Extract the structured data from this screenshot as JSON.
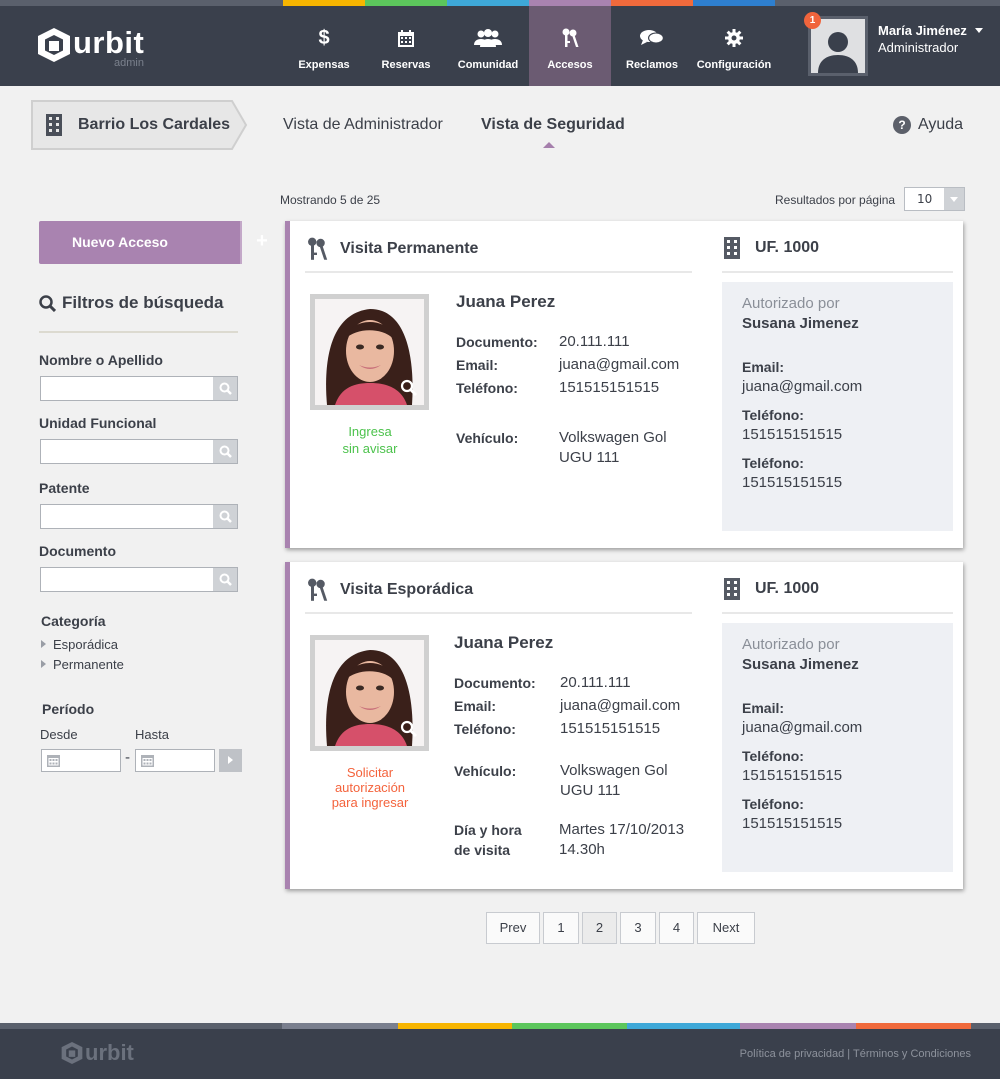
{
  "brand": {
    "name": "urbit",
    "sub": "admin"
  },
  "colors": {
    "stripe": [
      "#5a606c",
      "#f7b500",
      "#5cc65c",
      "#3ea8d8",
      "#a983b0",
      "#f06a3c",
      "#2e7fcf",
      "#5a606c"
    ],
    "accent": "#a983b0",
    "status_ok": "#4cc24c",
    "status_warn": "#f4633c"
  },
  "nav": [
    {
      "label": "Expensas",
      "icon": "dollar-icon",
      "active": false
    },
    {
      "label": "Reservas",
      "icon": "calendar-icon",
      "active": false
    },
    {
      "label": "Comunidad",
      "icon": "people-icon",
      "active": false
    },
    {
      "label": "Accesos",
      "icon": "keys-icon",
      "active": true
    },
    {
      "label": "Reclamos",
      "icon": "chat-icon",
      "active": false
    },
    {
      "label": "Configuración",
      "icon": "gear-icon",
      "active": false
    }
  ],
  "user": {
    "name": "María Jiménez",
    "role": "Administrador",
    "notifications": "1"
  },
  "subheader": {
    "barrio": "Barrio Los Cardales",
    "tab_admin": "Vista de Administrador",
    "tab_security": "Vista de Seguridad",
    "help": "Ayuda"
  },
  "sidebar": {
    "new_button": "Nuevo Acceso",
    "new_plus": "+",
    "filters_title": "Filtros de búsqueda",
    "fields": [
      {
        "label": "Nombre o Apellido",
        "value": ""
      },
      {
        "label": "Unidad Funcional",
        "value": ""
      },
      {
        "label": "Patente",
        "value": ""
      },
      {
        "label": "Documento",
        "value": ""
      }
    ],
    "category_title": "Categoría",
    "categories": [
      "Esporádica",
      "Permanente"
    ],
    "period_title": "Período",
    "from_label": "Desde",
    "to_label": "Hasta",
    "dash": "-"
  },
  "results": {
    "showing": "Mostrando 5 de 25",
    "per_page_label": "Resultados por página",
    "per_page_value": "10"
  },
  "cards": [
    {
      "title": "Visita Permanente",
      "uf": "UF. 1000",
      "name": "Juana Perez",
      "status": "Ingresa\nsin avisar",
      "doc_label": "Documento:",
      "doc": "20.111.111",
      "email_label": "Email:",
      "email": "juana@gmail.com",
      "phone_label": "Teléfono:",
      "phone": "151515151515",
      "vehicle_label": "Vehículo:",
      "vehicle": "Volkswagen Gol\nUGU 111",
      "auth_by_label": "Autorizado por",
      "auth_by": "Susana Jimenez",
      "auth_email_label": "Email:",
      "auth_email": "juana@gmail.com",
      "auth_phone_label": "Teléfono:",
      "auth_phone": "151515151515",
      "auth_phone2_label": "Teléfono:",
      "auth_phone2": "151515151515"
    },
    {
      "title": "Visita Esporádica",
      "uf": "UF. 1000",
      "name": "Juana Perez",
      "status": "Solicitar\nautorización\npara ingresar",
      "doc_label": "Documento:",
      "doc": "20.111.111",
      "email_label": "Email:",
      "email": "juana@gmail.com",
      "phone_label": "Teléfono:",
      "phone": "151515151515",
      "vehicle_label": "Vehículo:",
      "vehicle": "Volkswagen Gol\nUGU 111",
      "date_label": "Día y hora\nde visita",
      "date": "Martes 17/10/2013\n14.30h",
      "auth_by_label": "Autorizado por",
      "auth_by": "Susana Jimenez",
      "auth_email_label": "Email:",
      "auth_email": "juana@gmail.com",
      "auth_phone_label": "Teléfono:",
      "auth_phone": "151515151515",
      "auth_phone2_label": "Teléfono:",
      "auth_phone2": "151515151515"
    }
  ],
  "pagination": {
    "prev": "Prev",
    "pages": [
      "1",
      "2",
      "3",
      "4"
    ],
    "current": "2",
    "next": "Next"
  },
  "footer": {
    "privacy": "Política de privacidad",
    "sep": "|",
    "terms": "Términos y Condiciones"
  }
}
